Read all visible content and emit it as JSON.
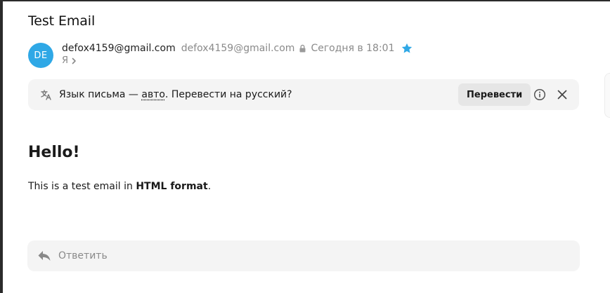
{
  "message": {
    "subject": "Test Email",
    "sender": {
      "avatar_initials": "DE",
      "avatar_color": "#2fa8e6",
      "name": "defox4159@gmail.com",
      "email": "defox4159@gmail.com",
      "date": "Сегодня в 18:01",
      "starred": true
    },
    "recipient": "Я"
  },
  "translate_bar": {
    "text_before": "Язык письма — ",
    "auto_link": "авто",
    "text_after": ". Перевести на русский?",
    "button_label": "Перевести"
  },
  "body": {
    "heading": "Hello!",
    "text_before": "This is a test email in ",
    "text_bold": "HTML format",
    "text_after": "."
  },
  "reply": {
    "label": "Ответить"
  },
  "colors": {
    "accent": "#2fa8e6",
    "panel_bg": "#f4f4f4",
    "muted_text": "#8a8a8a"
  }
}
